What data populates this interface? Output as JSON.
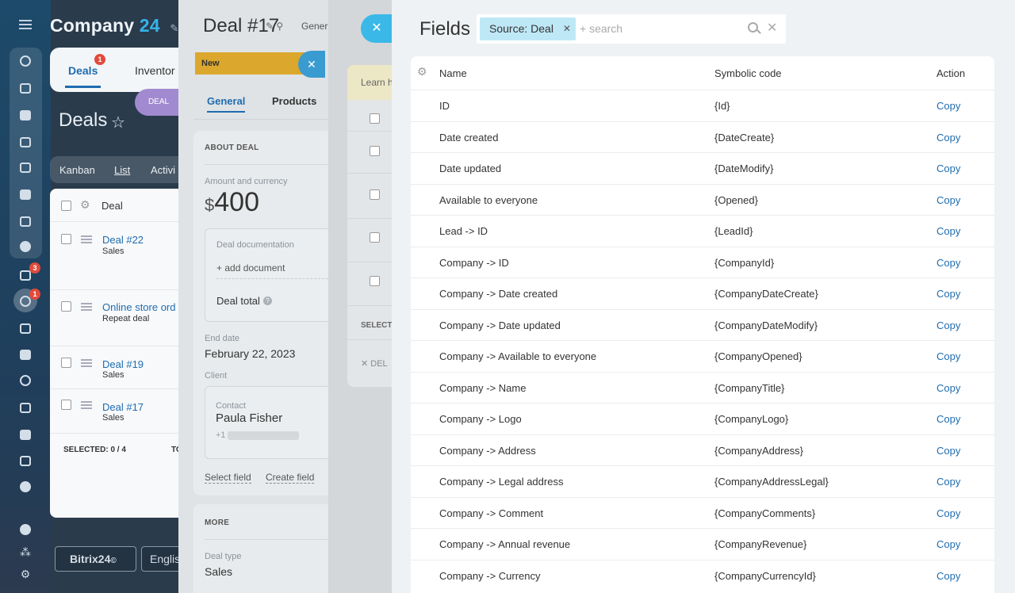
{
  "company": {
    "name": "Company",
    "number": "24"
  },
  "rail": {
    "badges": {
      "tasks": "3",
      "crm": "1"
    }
  },
  "deals": {
    "tabs": [
      "Deals",
      "Inventor"
    ],
    "deals_tab_badge": "1",
    "pill": "DEAL",
    "title": "Deals",
    "views": [
      "Kanban",
      "List",
      "Activi"
    ],
    "column": "Deal",
    "rows": [
      {
        "title": "Deal #22",
        "sub": "Sales"
      },
      {
        "title": "Online store ord",
        "sub": "Repeat deal"
      },
      {
        "title": "Deal #19",
        "sub": "Sales"
      },
      {
        "title": "Deal #17",
        "sub": "Sales"
      }
    ],
    "selected": "SELECTED: 0 / 4",
    "to_label": "TO",
    "footer": {
      "brand": "Bitrix24",
      "lang": "Englis"
    }
  },
  "deal17": {
    "title": "Deal #17",
    "gener": "Gener",
    "stage": "New",
    "tabs": [
      "General",
      "Products"
    ],
    "section_about": "ABOUT DEAL",
    "amount_label": "Amount and currency",
    "currency": "$",
    "amount": "400",
    "doc_label": "Deal documentation",
    "add_doc": "+ add document",
    "deal_total": "Deal total",
    "end_label": "End date",
    "end_value": "February 22, 2023",
    "client_label": "Client",
    "contact_label": "Contact",
    "contact_name": "Paula Fisher",
    "phone_prefix": "+1",
    "select_field": "Select field",
    "create_field": "Create field",
    "more": "MORE",
    "deal_type_label": "Deal type",
    "deal_type_value": "Sales"
  },
  "middle": {
    "learn": "Learn h",
    "select": "SELECT",
    "del": "DEL"
  },
  "fields": {
    "title": "Fields",
    "chip": "Source: Deal",
    "placeholder": "+ search",
    "columns": {
      "name": "Name",
      "code": "Symbolic code",
      "action": "Action"
    },
    "rows": [
      {
        "name": "ID",
        "code": "{Id}",
        "action": "Copy"
      },
      {
        "name": "Date created",
        "code": "{DateCreate}",
        "action": "Copy"
      },
      {
        "name": "Date updated",
        "code": "{DateModify}",
        "action": "Copy"
      },
      {
        "name": "Available to everyone",
        "code": "{Opened}",
        "action": "Copy"
      },
      {
        "name": "Lead -> ID",
        "code": "{LeadId}",
        "action": "Copy"
      },
      {
        "name": "Company -> ID",
        "code": "{CompanyId}",
        "action": "Copy"
      },
      {
        "name": "Company -> Date created",
        "code": "{CompanyDateCreate}",
        "action": "Copy"
      },
      {
        "name": "Company -> Date updated",
        "code": "{CompanyDateModify}",
        "action": "Copy"
      },
      {
        "name": "Company -> Available to everyone",
        "code": "{CompanyOpened}",
        "action": "Copy"
      },
      {
        "name": "Company -> Name",
        "code": "{CompanyTitle}",
        "action": "Copy"
      },
      {
        "name": "Company -> Logo",
        "code": "{CompanyLogo}",
        "action": "Copy"
      },
      {
        "name": "Company -> Address",
        "code": "{CompanyAddress}",
        "action": "Copy"
      },
      {
        "name": "Company -> Legal address",
        "code": "{CompanyAddressLegal}",
        "action": "Copy"
      },
      {
        "name": "Company -> Comment",
        "code": "{CompanyComments}",
        "action": "Copy"
      },
      {
        "name": "Company -> Annual revenue",
        "code": "{CompanyRevenue}",
        "action": "Copy"
      },
      {
        "name": "Company -> Currency",
        "code": "{CompanyCurrencyId}",
        "action": "Copy"
      }
    ]
  }
}
